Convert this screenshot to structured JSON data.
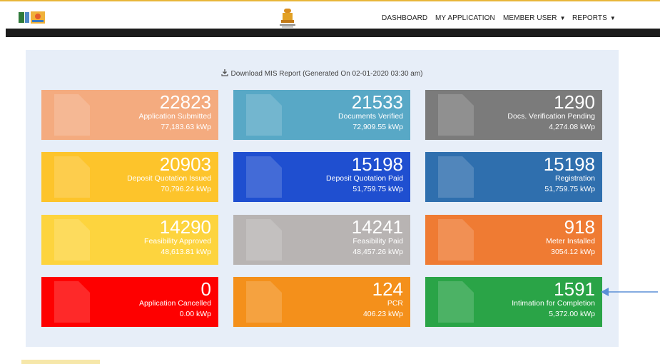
{
  "header": {
    "nav": [
      {
        "label": "DASHBOARD",
        "caret": ""
      },
      {
        "label": "MY APPLICATION",
        "caret": ""
      },
      {
        "label": "MEMBER USER",
        "caret": "▼"
      },
      {
        "label": "REPORTS",
        "caret": "▼"
      }
    ]
  },
  "panel": {
    "download_label": "Download MIS Report (Generated On 02-01-2020 03:30 am)"
  },
  "tiles": [
    {
      "count": "22823",
      "label": "Application Submitted",
      "capacity": "77,183.63 kWp",
      "color": "#f4ab7f"
    },
    {
      "count": "21533",
      "label": "Documents Verified",
      "capacity": "72,909.55 kWp",
      "color": "#58a8c6"
    },
    {
      "count": "1290",
      "label": "Docs. Verification Pending",
      "capacity": "4,274.08 kWp",
      "color": "#7b7b7b"
    },
    {
      "count": "20903",
      "label": "Deposit Quotation Issued",
      "capacity": "70,796.24 kWp",
      "color": "#fdc42b"
    },
    {
      "count": "15198",
      "label": "Deposit Quotation Paid",
      "capacity": "51,759.75 kWp",
      "color": "#1f4fd0"
    },
    {
      "count": "15198",
      "label": "Registration",
      "capacity": "51,759.75 kWp",
      "color": "#2f6fae"
    },
    {
      "count": "14290",
      "label": "Feasibility Approved",
      "capacity": "48,613.81 kWp",
      "color": "#fdd43e"
    },
    {
      "count": "14241",
      "label": "Feasibility Paid",
      "capacity": "48,457.26 kWp",
      "color": "#b8b4b3"
    },
    {
      "count": "918",
      "label": "Meter Installed",
      "capacity": "3054.12 kWp",
      "color": "#ef7b33"
    },
    {
      "count": "0",
      "label": "Application Cancelled",
      "capacity": "0.00 kWp",
      "color": "#fe0000"
    },
    {
      "count": "124",
      "label": "PCR",
      "capacity": "406.23 kWp",
      "color": "#f4901b"
    },
    {
      "count": "1591",
      "label": "Intimation for Completion",
      "capacity": "5,372.00 kWp",
      "color": "#2aa447"
    }
  ]
}
